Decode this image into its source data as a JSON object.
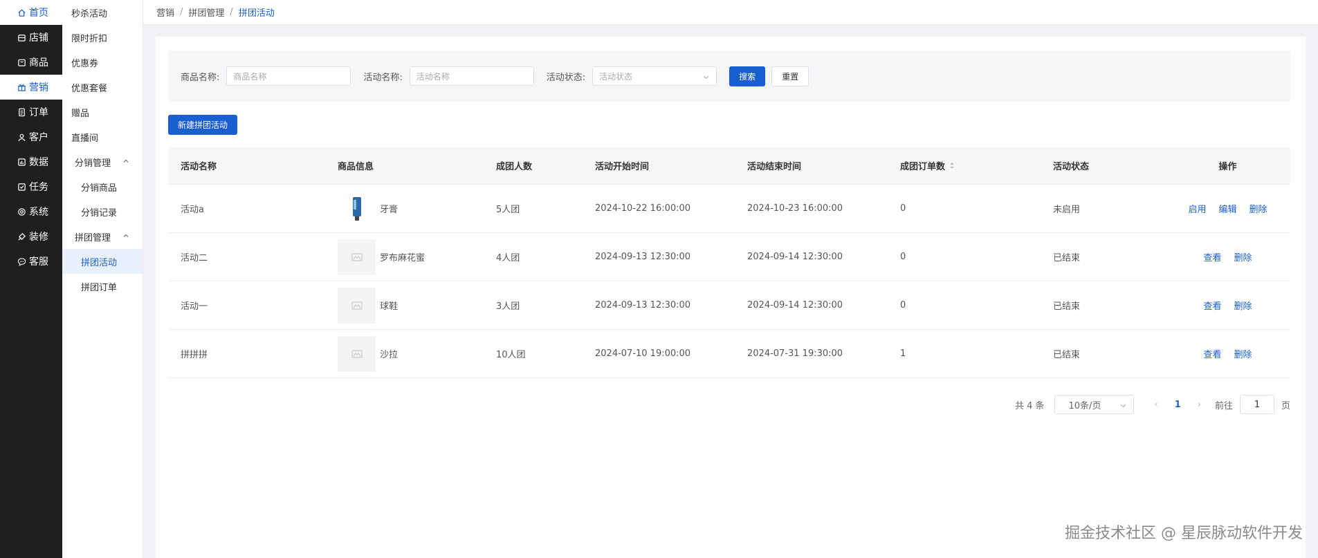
{
  "nav": {
    "items": [
      {
        "label": "首页",
        "icon": "home-icon"
      },
      {
        "label": "店铺",
        "icon": "store-icon"
      },
      {
        "label": "商品",
        "icon": "goods-icon"
      },
      {
        "label": "营销",
        "icon": "gift-icon"
      },
      {
        "label": "订单",
        "icon": "order-icon"
      },
      {
        "label": "客户",
        "icon": "customer-icon"
      },
      {
        "label": "数据",
        "icon": "data-icon"
      },
      {
        "label": "任务",
        "icon": "task-icon"
      },
      {
        "label": "系统",
        "icon": "settings-icon"
      },
      {
        "label": "装修",
        "icon": "decorate-icon"
      },
      {
        "label": "客服",
        "icon": "chat-icon"
      }
    ]
  },
  "sub": {
    "items": [
      "秒杀活动",
      "限时折扣",
      "优惠券",
      "优惠套餐",
      "赠品",
      "直播间"
    ],
    "group1": {
      "label": "分销管理",
      "children": [
        "分销商品",
        "分销记录"
      ]
    },
    "group2": {
      "label": "拼团管理",
      "children": [
        "拼团活动",
        "拼团订单"
      ]
    }
  },
  "breadcrumb": [
    "营销",
    "拼团管理",
    "拼团活动"
  ],
  "filter": {
    "product_label": "商品名称:",
    "product_placeholder": "商品名称",
    "activity_label": "活动名称:",
    "activity_placeholder": "活动名称",
    "status_label": "活动状态:",
    "status_placeholder": "活动状态",
    "search": "搜索",
    "reset": "重置"
  },
  "new_button": "新建拼团活动",
  "table": {
    "headers": [
      "活动名称",
      "商品信息",
      "成团人数",
      "活动开始时间",
      "活动结束时间",
      "成团订单数",
      "活动状态",
      "操作"
    ],
    "rows": [
      {
        "name": "活动a",
        "product": "牙膏",
        "size": "5人团",
        "start": "2024-10-22 16:00:00",
        "end": "2024-10-23 16:00:00",
        "orders": "0",
        "status": "未启用",
        "actions": [
          "启用",
          "编辑",
          "删除"
        ]
      },
      {
        "name": "活动二",
        "product": "罗布麻花蜜",
        "size": "4人团",
        "start": "2024-09-13 12:30:00",
        "end": "2024-09-14 12:30:00",
        "orders": "0",
        "status": "已结束",
        "actions": [
          "查看",
          "删除"
        ]
      },
      {
        "name": "活动一",
        "product": "球鞋",
        "size": "3人团",
        "start": "2024-09-13 12:30:00",
        "end": "2024-09-14 12:30:00",
        "orders": "0",
        "status": "已结束",
        "actions": [
          "查看",
          "删除"
        ]
      },
      {
        "name": "拼拼拼",
        "product": "沙拉",
        "size": "10人团",
        "start": "2024-07-10 19:00:00",
        "end": "2024-07-31 19:30:00",
        "orders": "1",
        "status": "已结束",
        "actions": [
          "查看",
          "删除"
        ]
      }
    ]
  },
  "pager": {
    "total": "共 4 条",
    "page_size": "10条/页",
    "current": "1",
    "goto_label": "前往",
    "goto_value": "1",
    "page_suffix": "页"
  },
  "watermark": "掘金技术社区 @ 星辰脉动软件开发",
  "colors": {
    "accent": "#1a5fd1",
    "nav_bg": "#1f1f1f"
  }
}
